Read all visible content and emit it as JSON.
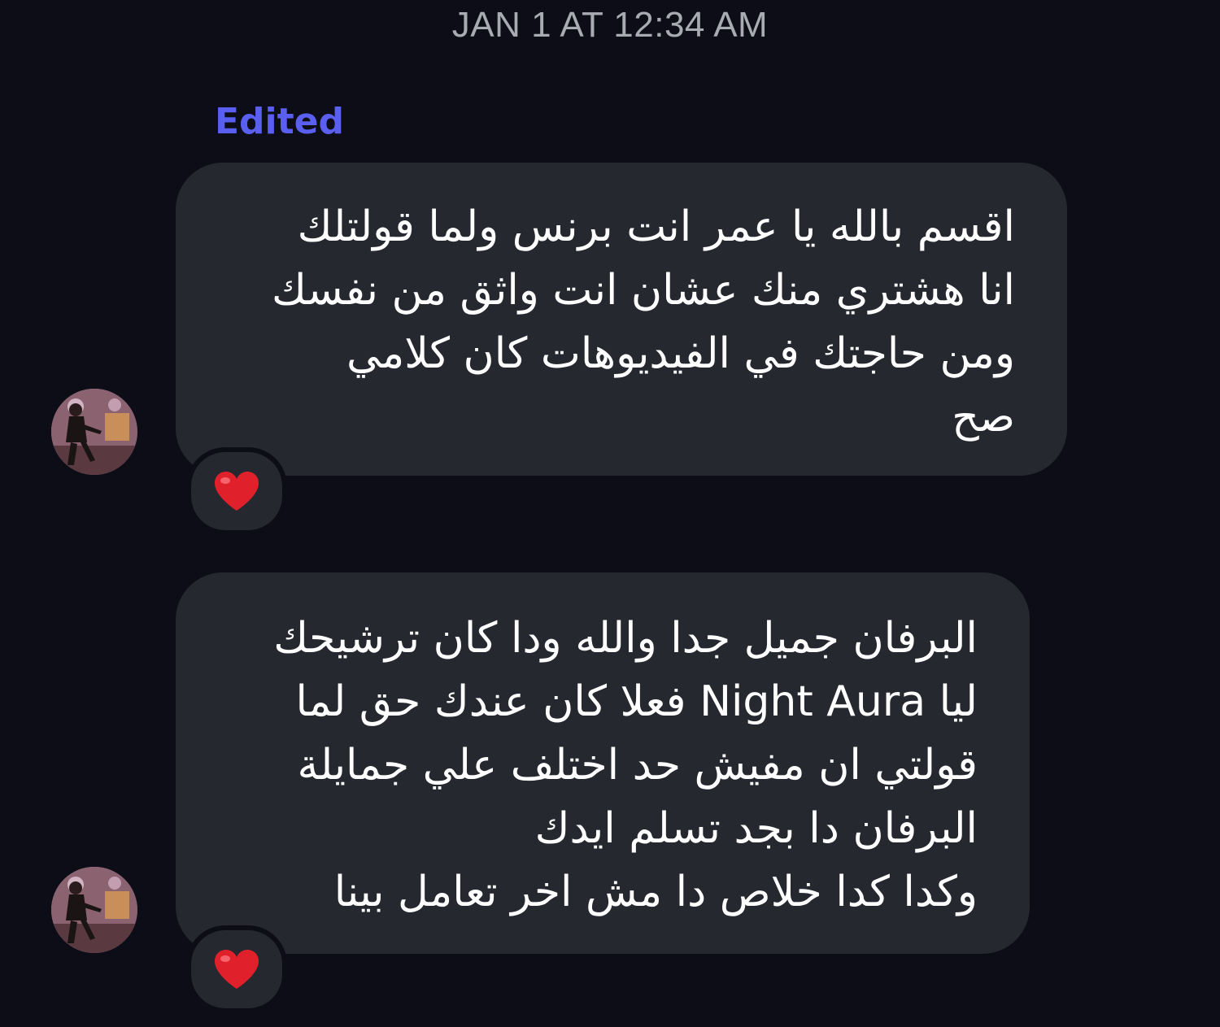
{
  "header": {
    "timestamp": "JAN 1 AT 12:34 AM"
  },
  "messages": [
    {
      "edited_label": "Edited",
      "lines": [
        "اقسم بالله يا عمر انت برنس ولما قولتلك",
        "انا هشتري منك عشان انت واثق من نفسك",
        "ومن حاجتك في الفيديوهات كان كلامي",
        "صح"
      ],
      "reaction": "heart-icon"
    },
    {
      "lines": [
        "البرفان جميل جدا والله ودا كان ترشيحك",
        "ليا Night Aura فعلا كان عندك حق لما",
        "قولتي ان مفيش حد اختلف علي جمايلة",
        "البرفان دا بجد تسلم ايدك",
        "وكدا كدا خلاص دا مش اخر تعامل بينا"
      ],
      "reaction": "heart-icon"
    }
  ],
  "colors": {
    "background": "#0c0d17",
    "bubble": "#262830",
    "edited_accent": "#5a5ff0",
    "timestamp": "#a9abb3",
    "heart": "#e0212b"
  }
}
